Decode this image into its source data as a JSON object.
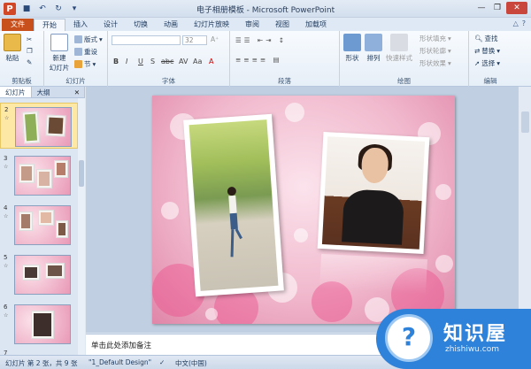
{
  "window": {
    "title": "电子相册模板 - Microsoft PowerPoint",
    "app_icon": "P"
  },
  "tabs": [
    "文件",
    "开始",
    "插入",
    "设计",
    "切换",
    "动画",
    "幻灯片放映",
    "审阅",
    "视图",
    "加载项"
  ],
  "ribbon": {
    "clipboard": {
      "label": "剪贴板",
      "paste": "粘贴"
    },
    "slides": {
      "label": "幻灯片",
      "new_slide": "新建\n幻灯片",
      "layout": "版式",
      "reset": "重设",
      "section": "节"
    },
    "font": {
      "label": "字体",
      "size": "32",
      "buttons": [
        "B",
        "I",
        "U",
        "S",
        "abc",
        "AV",
        "Aa",
        "A"
      ]
    },
    "paragraph": {
      "label": "段落"
    },
    "drawing": {
      "label": "绘图",
      "shape": "形状",
      "arrange": "排列",
      "quick_styles": "快速样式",
      "fill": "形状填充",
      "outline": "形状轮廓",
      "effects": "形状效果"
    },
    "editing": {
      "label": "编辑",
      "find": "查找",
      "replace": "替换",
      "select": "选择"
    }
  },
  "pane": {
    "tabs": [
      "幻灯片",
      "大纲"
    ],
    "close": "✕",
    "slide_numbers": [
      "2",
      "3",
      "4",
      "5",
      "6",
      "7"
    ]
  },
  "notes": {
    "placeholder": "单击此处添加备注"
  },
  "status": {
    "slide": "幻灯片 第 2 张，共 9 张",
    "theme": "\"1_Default Design\"",
    "language": "中文(中国)"
  },
  "watermark": {
    "text": "知识屋",
    "url": "zhishiwu.com",
    "icon": "?"
  },
  "colors": {
    "file_tab": "#c8501c",
    "watermark": "#2f82d9",
    "slide_bg": "#f1b9cd"
  }
}
